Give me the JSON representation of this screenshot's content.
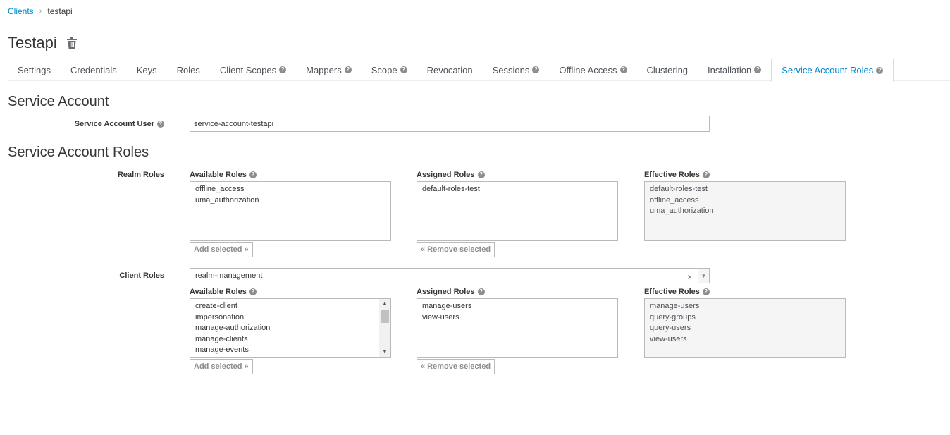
{
  "breadcrumb": {
    "parent": "Clients",
    "separator": "›",
    "current": "testapi"
  },
  "page": {
    "title": "Testapi"
  },
  "tabs": [
    {
      "label": "Settings",
      "help": false
    },
    {
      "label": "Credentials",
      "help": false
    },
    {
      "label": "Keys",
      "help": false
    },
    {
      "label": "Roles",
      "help": false
    },
    {
      "label": "Client Scopes",
      "help": true
    },
    {
      "label": "Mappers",
      "help": true
    },
    {
      "label": "Scope",
      "help": true
    },
    {
      "label": "Revocation",
      "help": false
    },
    {
      "label": "Sessions",
      "help": true
    },
    {
      "label": "Offline Access",
      "help": true
    },
    {
      "label": "Clustering",
      "help": false
    },
    {
      "label": "Installation",
      "help": true
    },
    {
      "label": "Service Account Roles",
      "help": true,
      "active": true
    }
  ],
  "service_account": {
    "heading": "Service Account",
    "user_label": "Service Account User",
    "user_value": "service-account-testapi"
  },
  "roles": {
    "heading": "Service Account Roles",
    "realm": {
      "label": "Realm Roles",
      "available_label": "Available Roles",
      "assigned_label": "Assigned Roles",
      "effective_label": "Effective Roles",
      "available": [
        "offline_access",
        "uma_authorization"
      ],
      "assigned": [
        "default-roles-test"
      ],
      "effective": [
        "default-roles-test",
        "offline_access",
        "uma_authorization"
      ],
      "add_button": "Add selected »",
      "remove_button": "« Remove selected"
    },
    "client": {
      "label": "Client Roles",
      "selected_client": "realm-management",
      "clear_symbol": "×",
      "available_label": "Available Roles",
      "assigned_label": "Assigned Roles",
      "effective_label": "Effective Roles",
      "available": [
        "create-client",
        "impersonation",
        "manage-authorization",
        "manage-clients",
        "manage-events"
      ],
      "assigned": [
        "manage-users",
        "view-users"
      ],
      "effective": [
        "manage-users",
        "query-groups",
        "query-users",
        "view-users"
      ],
      "add_button": "Add selected »",
      "remove_button": "« Remove selected"
    }
  },
  "icons": {
    "help": "question-circle-icon",
    "delete": "trash-icon"
  },
  "colors": {
    "link": "#0088ce",
    "text": "#363636",
    "muted": "#8b8d8f",
    "border": "#bababa"
  }
}
